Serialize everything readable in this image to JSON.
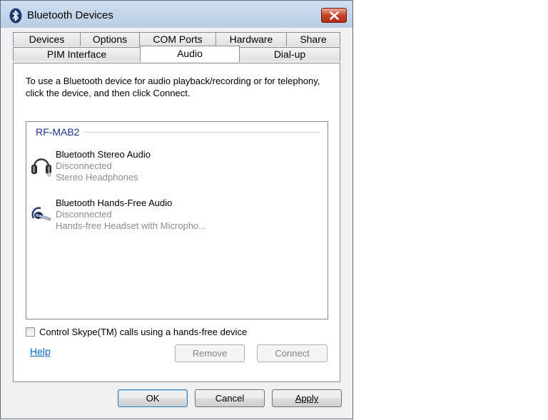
{
  "window": {
    "title": "Bluetooth Devices"
  },
  "tabs": {
    "row_back": [
      "Devices",
      "Options",
      "COM Ports",
      "Hardware",
      "Share"
    ],
    "row_front": [
      "PIM Interface",
      "Audio",
      "Dial-up"
    ],
    "active": "Audio"
  },
  "audio": {
    "description": "To use a Bluetooth device for audio playback/recording or for telephony, click the device, and then click Connect.",
    "group_name": "RF-MAB2",
    "devices": [
      {
        "name": "Bluetooth Stereo Audio",
        "status": "Disconnected",
        "type": "Stereo Headphones",
        "icon": "headphones-icon"
      },
      {
        "name": "Bluetooth Hands-Free Audio",
        "status": "Disconnected",
        "type": "Hands-free Headset with Micropho...",
        "icon": "headset-icon"
      }
    ],
    "skype_checkbox": {
      "label": "Control Skype(TM) calls using a hands-free device",
      "checked": false
    },
    "help_link": "Help",
    "remove_label": "Remove",
    "connect_label": "Connect"
  },
  "footer": {
    "ok_label": "OK",
    "cancel_label": "Cancel",
    "apply_label": "Apply"
  },
  "colors": {
    "link": "#0066cc",
    "group_header": "#1e3287",
    "close_button": "#c7422a"
  }
}
